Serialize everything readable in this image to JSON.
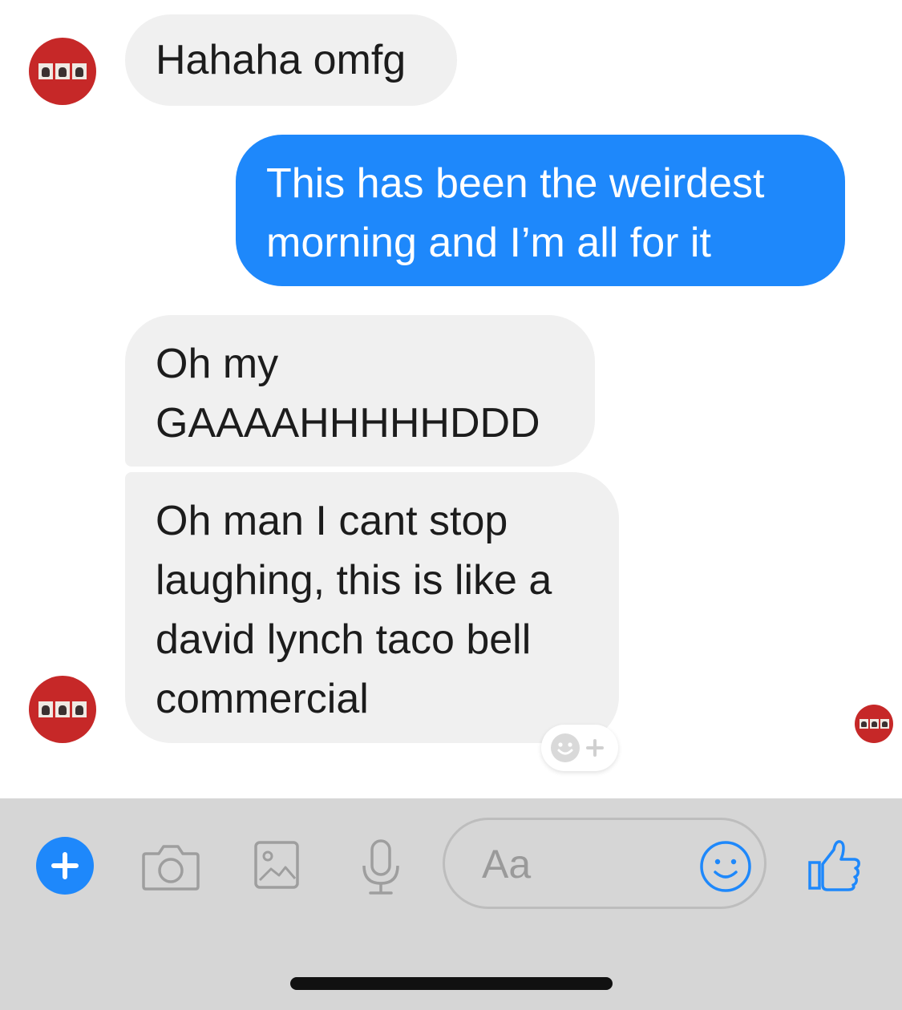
{
  "messages": [
    {
      "sender": "contact",
      "text": "Hahaha omfg"
    },
    {
      "sender": "me",
      "text": "This has been the weirdest\nmorning and I’m all for it"
    },
    {
      "sender": "contact",
      "text": "Oh my\nGAAAAHHHHHDDD"
    },
    {
      "sender": "contact",
      "text": "Oh man I cant stop\nlaughing, this is like a\ndavid lynch taco bell\ncommercial"
    }
  ],
  "composer": {
    "placeholder": "Aa",
    "icons": [
      "plus-icon",
      "camera-icon",
      "gallery-icon",
      "microphone-icon",
      "smiley-icon",
      "thumbs-up-icon"
    ]
  },
  "colors": {
    "outgoing_bubble": "#1e88fb",
    "incoming_bubble": "#f0f0f0",
    "composer_bg": "#d6d6d6",
    "accent": "#1e88fb",
    "avatar": "#c62828"
  }
}
